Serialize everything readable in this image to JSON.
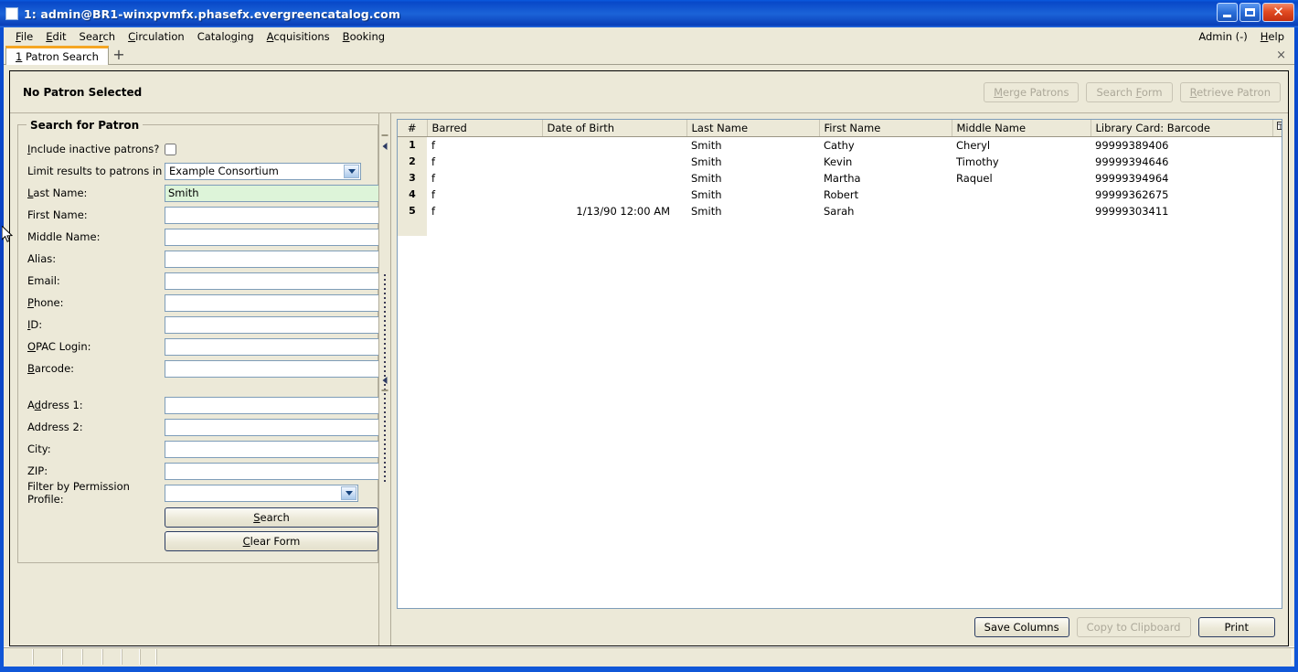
{
  "window": {
    "title": "1: admin@BR1-winxpvmfx.phasefx.evergreencatalog.com",
    "minimize_label": "_",
    "maximize_label": "",
    "close_label": "✕"
  },
  "menubar": {
    "items": [
      {
        "label": "File",
        "accel": "F"
      },
      {
        "label": "Edit",
        "accel": "E"
      },
      {
        "label": "Search",
        "accel": "r"
      },
      {
        "label": "Circulation",
        "accel": "C"
      },
      {
        "label": "Cataloging",
        "accel": "g"
      },
      {
        "label": "Acquisitions",
        "accel": "A"
      },
      {
        "label": "Booking",
        "accel": "B"
      }
    ],
    "right_items": [
      {
        "label": "Admin (-)",
        "accel": ""
      },
      {
        "label": "Help",
        "accel": "H"
      }
    ]
  },
  "tabs": {
    "items": [
      {
        "number": "1",
        "label": "Patron Search"
      }
    ],
    "add_label": "+",
    "close_label": "×"
  },
  "patron_bar": {
    "title": "No Patron Selected",
    "buttons": [
      {
        "label": "Merge Patrons",
        "accel": "M",
        "disabled": true
      },
      {
        "label": "Search Form",
        "accel": "F",
        "disabled": true
      },
      {
        "label": "Retrieve Patron",
        "accel": "R",
        "disabled": true
      }
    ]
  },
  "search_form": {
    "legend": "Search for Patron",
    "include_inactive_label": "Include inactive patrons?",
    "include_inactive_checked": false,
    "limit_results_label": "Limit results to patrons in",
    "limit_results_value": "Example Consortium",
    "fields": [
      {
        "label": "Last Name:",
        "value": "Smith",
        "focused": true
      },
      {
        "label": "First Name:",
        "value": "",
        "focused": false
      },
      {
        "label": "Middle Name:",
        "value": "",
        "focused": false
      },
      {
        "label": "Alias:",
        "value": "",
        "focused": false
      },
      {
        "label": "Email:",
        "value": "",
        "focused": false
      },
      {
        "label": "Phone:",
        "value": "",
        "focused": false
      },
      {
        "label": "ID:",
        "value": "",
        "focused": false
      },
      {
        "label": "OPAC Login:",
        "value": "",
        "focused": false
      },
      {
        "label": "Barcode:",
        "value": "",
        "focused": false
      }
    ],
    "address_fields": [
      {
        "label": "Address 1:",
        "value": ""
      },
      {
        "label": "Address 2:",
        "value": ""
      },
      {
        "label": "City:",
        "value": ""
      },
      {
        "label": "ZIP:",
        "value": ""
      }
    ],
    "permission_profile_label": "Filter by Permission Profile:",
    "permission_profile_value": "",
    "search_button": "Search",
    "clear_button": "Clear Form"
  },
  "results": {
    "columns": [
      "#",
      "Barred",
      "Date of Birth",
      "Last Name",
      "First Name",
      "Middle Name",
      "Library Card: Barcode"
    ],
    "column_picker_icon": "column-picker-icon",
    "rows": [
      {
        "num": "1",
        "barred": "f",
        "dob": "",
        "last": "Smith",
        "first": "Cathy",
        "middle": "Cheryl",
        "barcode": "99999389406"
      },
      {
        "num": "2",
        "barred": "f",
        "dob": "",
        "last": "Smith",
        "first": "Kevin",
        "middle": "Timothy",
        "barcode": "99999394646"
      },
      {
        "num": "3",
        "barred": "f",
        "dob": "",
        "last": "Smith",
        "first": "Martha",
        "middle": "Raquel",
        "barcode": "99999394964"
      },
      {
        "num": "4",
        "barred": "f",
        "dob": "",
        "last": "Smith",
        "first": "Robert",
        "middle": "",
        "barcode": "99999362675"
      },
      {
        "num": "5",
        "barred": "f",
        "dob": "1/13/90 12:00 AM",
        "last": "Smith",
        "first": "Sarah",
        "middle": "",
        "barcode": "99999303411"
      }
    ],
    "footer_buttons": [
      {
        "label": "Save Columns",
        "disabled": false
      },
      {
        "label": "Copy to Clipboard",
        "disabled": true
      },
      {
        "label": "Print",
        "disabled": false
      }
    ]
  },
  "statusbar": {
    "cells": [
      "",
      "",
      "",
      "",
      "",
      "",
      "",
      ""
    ]
  },
  "colors": {
    "titlebar_blue": "#0a4fcc",
    "chrome": "#ece9d8",
    "tab_accent": "#f5a623",
    "field_border": "#7e9db9",
    "focused_field": "#ddf4d9"
  }
}
